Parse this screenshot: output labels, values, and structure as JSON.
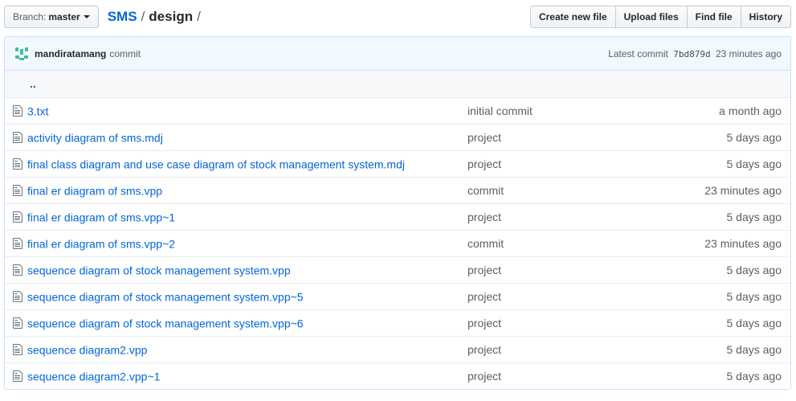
{
  "toolbar": {
    "branch_prefix": "Branch:",
    "branch_name": "master",
    "repo": "SMS",
    "sep1": "/",
    "dir": "design",
    "sep2": "/",
    "buttons": [
      "Create new file",
      "Upload files",
      "Find file",
      "History"
    ]
  },
  "commit": {
    "author": "mandiratamang",
    "message": "commit",
    "latest_label": "Latest commit",
    "sha": "7bd879d",
    "age": "23 minutes ago",
    "avatar_color": "#3fbfa8"
  },
  "up_dir": "..",
  "files": [
    {
      "name": "3.txt",
      "message": "initial commit",
      "age": "a month ago"
    },
    {
      "name": "activity diagram of sms.mdj",
      "message": "project",
      "age": "5 days ago"
    },
    {
      "name": "final class diagram and use case diagram of stock management system.mdj",
      "message": "project",
      "age": "5 days ago"
    },
    {
      "name": "final er diagram of sms.vpp",
      "message": "commit",
      "age": "23 minutes ago"
    },
    {
      "name": "final er diagram of sms.vpp~1",
      "message": "project",
      "age": "5 days ago"
    },
    {
      "name": "final er diagram of sms.vpp~2",
      "message": "commit",
      "age": "23 minutes ago"
    },
    {
      "name": "sequence diagram of stock management system.vpp",
      "message": "project",
      "age": "5 days ago"
    },
    {
      "name": "sequence diagram of stock management system.vpp~5",
      "message": "project",
      "age": "5 days ago"
    },
    {
      "name": "sequence diagram of stock management system.vpp~6",
      "message": "project",
      "age": "5 days ago"
    },
    {
      "name": "sequence diagram2.vpp",
      "message": "project",
      "age": "5 days ago"
    },
    {
      "name": "sequence diagram2.vpp~1",
      "message": "project",
      "age": "5 days ago"
    }
  ]
}
